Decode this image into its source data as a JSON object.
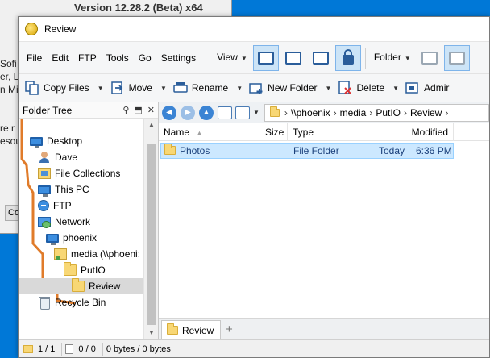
{
  "background_dialog": {
    "version_text": "Version 12.28.2 (Beta) x64",
    "fragments": [
      "Sofi",
      "er, L",
      "n Mi",
      "re r",
      "esou"
    ],
    "button_fragment": "Co"
  },
  "window": {
    "title": "Review"
  },
  "menu": {
    "items": [
      "File",
      "Edit",
      "FTP",
      "Tools",
      "Go",
      "Settings"
    ],
    "view_label": "View",
    "folder_label": "Folder"
  },
  "commands": {
    "copy_files": "Copy Files",
    "move": "Move",
    "rename": "Rename",
    "new_folder": "New Folder",
    "delete": "Delete",
    "admin": "Admir"
  },
  "folder_tree": {
    "title": "Folder Tree",
    "items": [
      {
        "label": "Desktop",
        "icon": "monitor-icon"
      },
      {
        "label": "Dave",
        "icon": "user-icon"
      },
      {
        "label": "File Collections",
        "icon": "collections-icon"
      },
      {
        "label": "This PC",
        "icon": "computer-icon"
      },
      {
        "label": "FTP",
        "icon": "ftp-icon"
      },
      {
        "label": "Network",
        "icon": "network-icon"
      },
      {
        "label": "phoenix",
        "icon": "computer-icon"
      },
      {
        "label": "media (\\\\phoeni:",
        "icon": "network-share-icon"
      },
      {
        "label": "PutIO",
        "icon": "folder-icon"
      },
      {
        "label": "Review",
        "icon": "folder-icon",
        "selected": true
      },
      {
        "label": "Recycle Bin",
        "icon": "recycle-bin-icon"
      }
    ]
  },
  "address": {
    "segments": [
      "\\\\phoenix",
      "media",
      "PutIO",
      "Review"
    ]
  },
  "columns": {
    "name": "Name",
    "size": "Size",
    "type": "Type",
    "modified": "Modified"
  },
  "files": [
    {
      "name": "Photos",
      "size": "",
      "type": "File Folder",
      "modified_day": "Today",
      "modified_time": "6:36 PM"
    }
  ],
  "tabs": [
    {
      "label": "Review"
    }
  ],
  "tab_add": "+",
  "status": {
    "folders": "1 / 1",
    "files": "0 / 0",
    "bytes": "0 bytes / 0 bytes"
  },
  "colors": {
    "desktop_bg": "#0078d7",
    "tree_line": "#e07b2a",
    "selection": "#cce8ff",
    "accent": "#3b84d4"
  }
}
